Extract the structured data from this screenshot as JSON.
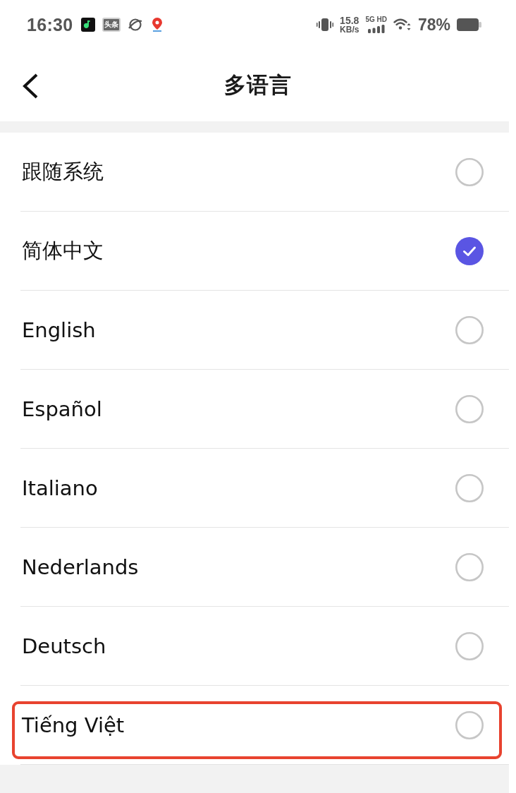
{
  "status_bar": {
    "time": "16:30",
    "app_icons": [
      {
        "kind": "music"
      },
      {
        "kind": "news",
        "label": "头条"
      },
      {
        "kind": "planet"
      },
      {
        "kind": "map-pin"
      }
    ],
    "net_speed": "15.8",
    "net_speed_unit": "KB/s",
    "network_type": "5G HD",
    "battery": "78%"
  },
  "header": {
    "title": "多语言"
  },
  "languages": [
    {
      "label": "跟随系统",
      "selected": false,
      "highlighted": false
    },
    {
      "label": "简体中文",
      "selected": true,
      "highlighted": false
    },
    {
      "label": "English",
      "selected": false,
      "highlighted": false
    },
    {
      "label": "Español",
      "selected": false,
      "highlighted": false
    },
    {
      "label": "Italiano",
      "selected": false,
      "highlighted": false
    },
    {
      "label": "Nederlands",
      "selected": false,
      "highlighted": false
    },
    {
      "label": "Deutsch",
      "selected": false,
      "highlighted": false
    },
    {
      "label": "Tiếng Việt",
      "selected": false,
      "highlighted": true
    }
  ]
}
